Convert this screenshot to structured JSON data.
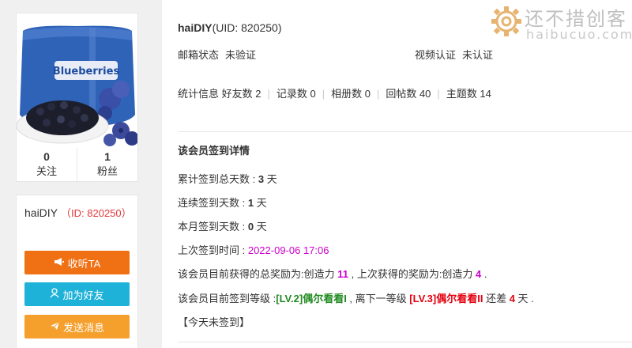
{
  "profile": {
    "following_count": "0",
    "following_label": "关注",
    "fans_count": "1",
    "fans_label": "粉丝",
    "package_brand": "Blueberries",
    "name": "haiDIY",
    "id_text": "（ID: 820250）"
  },
  "actions": {
    "listen": "收听TA",
    "add_friend": "加为好友",
    "send_message": "发送消息"
  },
  "header": {
    "username": "haiDIY",
    "uid_text": "(UID: 820250)"
  },
  "status": {
    "email_label": "邮箱状态",
    "email_value": "未验证",
    "video_label": "视频认证",
    "video_value": "未认证"
  },
  "counts": {
    "stats_label": "统计信息",
    "friends": "好友数 2",
    "records": "记录数 0",
    "albums": "相册数 0",
    "replies": "回帖数 40",
    "topics": "主题数 14"
  },
  "signin": {
    "section_title": "该会员签到详情",
    "total_label": "累计签到总天数 : ",
    "total_value": "3",
    "consecutive_label": "连续签到天数 : ",
    "consecutive_value": "1",
    "month_label": "本月签到天数 : ",
    "month_value": "0",
    "day_unit": " 天",
    "last_label": "上次签到时间 : ",
    "last_value": "2022-09-06 17:06",
    "reward_prefix": "该会员目前获得的总奖励为:创造力 ",
    "reward_total": "11",
    "reward_middle": " , 上次获得的奖励为:创造力 ",
    "reward_last": "4",
    "reward_suffix": " .",
    "level_prefix": "该会员目前签到等级 :",
    "level_current": "[LV.2]偶尔看看I",
    "level_middle": " , 离下一等级 ",
    "level_next": "[LV.3]偶尔看看II",
    "level_diff_prefix": " 还差 ",
    "level_diff": "4",
    "level_diff_suffix": " 天 .",
    "today_status": "【今天未签到】"
  },
  "watermark": {
    "text_cn": "还不措创客",
    "text_en": "haibucuo.com"
  },
  "colors": {
    "listen_button": "#f07014",
    "friend_button": "#1fb2d8",
    "message_button": "#f5a02d",
    "highlight_magenta": "#cc00cc",
    "level_green": "#228b22",
    "level_red": "#e4000f"
  },
  "icons": {
    "listen": "megaphone-icon",
    "add_friend": "add-user-icon",
    "send_message": "paper-plane-icon",
    "watermark": "gear-icon"
  }
}
